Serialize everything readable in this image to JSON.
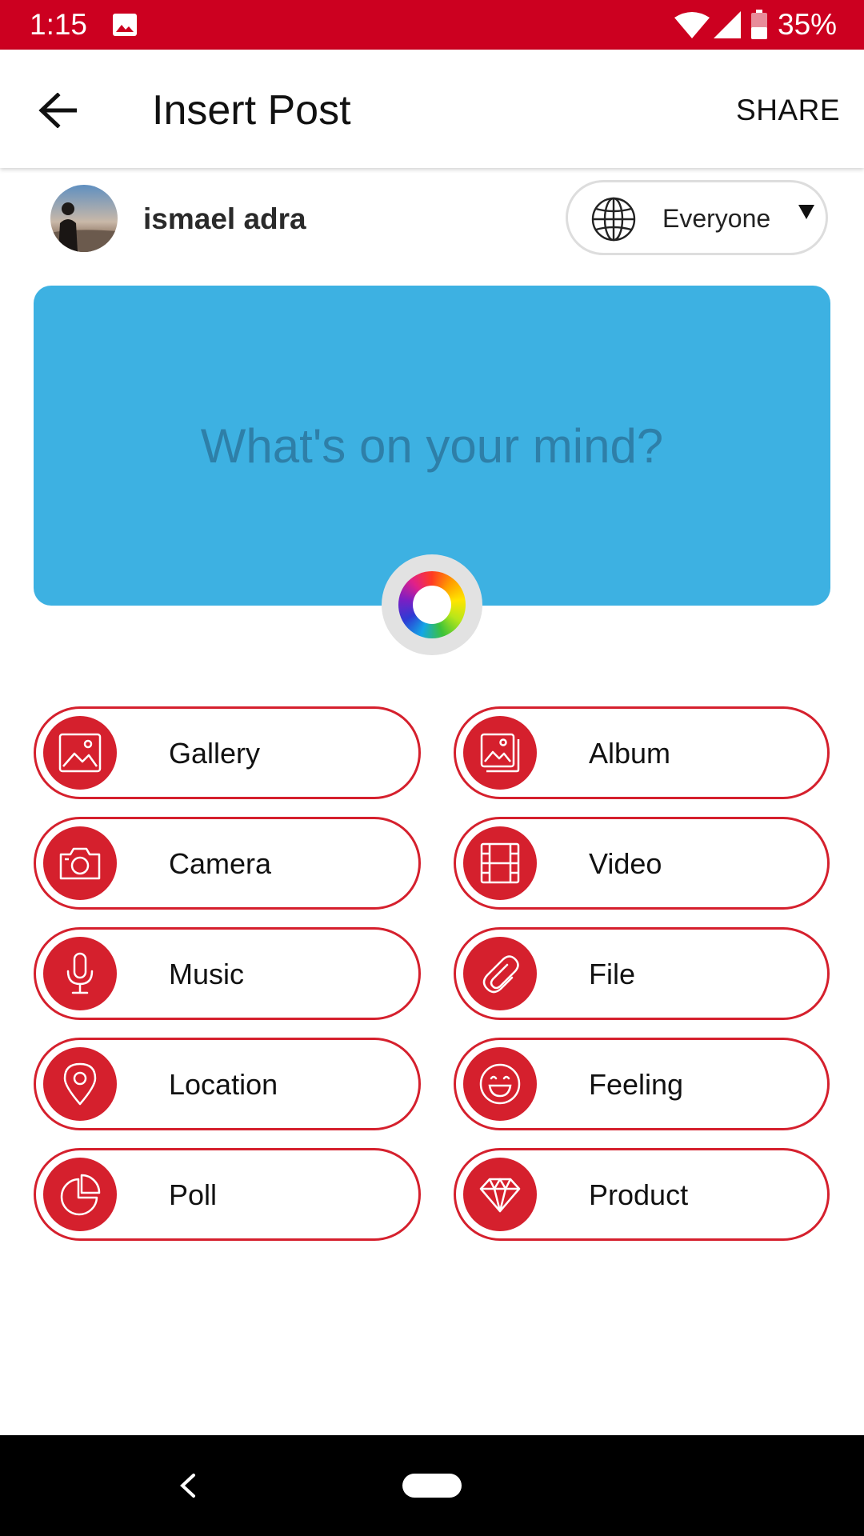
{
  "status_bar": {
    "time": "1:15",
    "battery": "35%",
    "icons": [
      "gallery-icon",
      "wifi-icon",
      "signal-icon",
      "battery-icon"
    ],
    "background_color": "#cc0020"
  },
  "app_bar": {
    "title": "Insert Post",
    "share_label": "SHARE",
    "back_icon": "arrow-left-icon"
  },
  "author": {
    "name": "ismael adra"
  },
  "privacy": {
    "label": "Everyone",
    "icon": "globe-icon"
  },
  "composer": {
    "placeholder": "What's on your mind?",
    "background_color": "#3db1e2",
    "color_picker_icon": "color-wheel-icon"
  },
  "actions": [
    {
      "label": "Gallery",
      "icon": "image-icon"
    },
    {
      "label": "Album",
      "icon": "album-icon"
    },
    {
      "label": "Camera",
      "icon": "camera-icon"
    },
    {
      "label": "Video",
      "icon": "film-icon"
    },
    {
      "label": "Music",
      "icon": "microphone-icon"
    },
    {
      "label": "File",
      "icon": "paperclip-icon"
    },
    {
      "label": "Location",
      "icon": "location-pin-icon"
    },
    {
      "label": "Feeling",
      "icon": "smiley-icon"
    },
    {
      "label": "Poll",
      "icon": "pie-chart-icon"
    },
    {
      "label": "Product",
      "icon": "diamond-icon"
    }
  ],
  "colors": {
    "accent": "#d5202d",
    "nav_bar": "#000000"
  }
}
